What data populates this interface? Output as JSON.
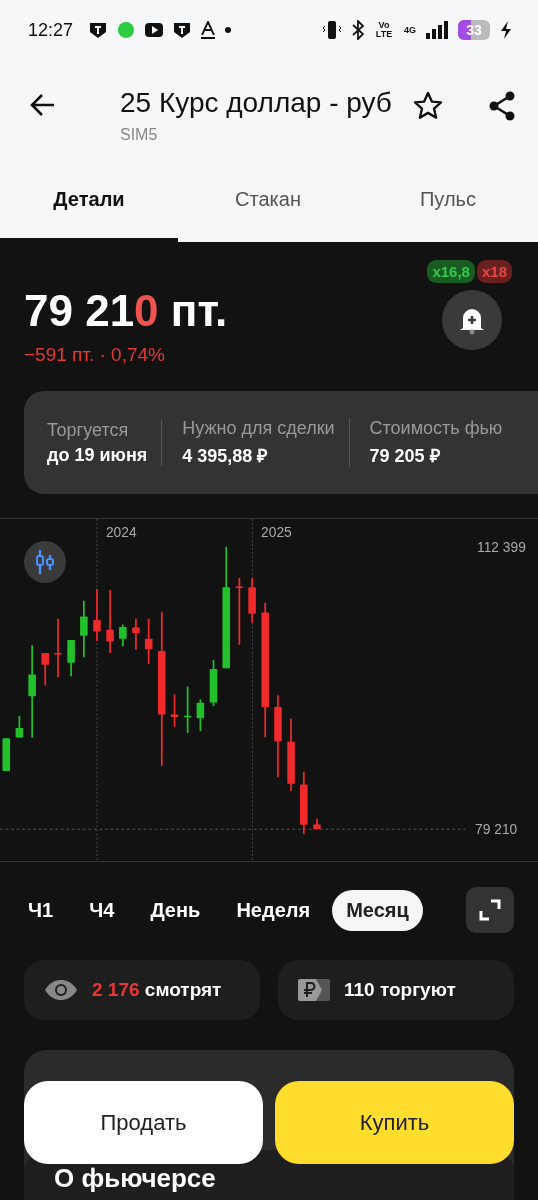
{
  "status_bar": {
    "time": "12:27",
    "network": "4G",
    "volte": "Vo LTE",
    "battery": "33"
  },
  "header": {
    "title": "25 Курс доллар - руб",
    "subtitle": "SIM5"
  },
  "tabs": [
    {
      "label": "Детали",
      "selected": true
    },
    {
      "label": "Стакан",
      "selected": false
    },
    {
      "label": "Пульс",
      "selected": false
    }
  ],
  "quote": {
    "price_parts": [
      {
        "text": "79 21",
        "highlight": false
      },
      {
        "text": "0",
        "highlight": true
      }
    ],
    "unit": "пт.",
    "change": "−591 пт. · 0,74%"
  },
  "leverage": [
    {
      "label": "x16,8",
      "color": "#185c22"
    },
    {
      "label": "x18",
      "color": "#6b2020"
    }
  ],
  "info": [
    {
      "label": "Торгуется",
      "value": "до 19 июня"
    },
    {
      "label": "Нужно для сделки",
      "value": "4 395,88 ₽"
    },
    {
      "label": "Стоимость фью",
      "value": "79 205 ₽"
    }
  ],
  "chart": {
    "years": [
      "2024",
      "2025"
    ],
    "price_high": "112 399",
    "price_last": "79 210"
  },
  "periods": [
    {
      "label": "Ч1",
      "selected": false
    },
    {
      "label": "Ч4",
      "selected": false
    },
    {
      "label": "День",
      "selected": false
    },
    {
      "label": "Неделя",
      "selected": false
    },
    {
      "label": "Месяц",
      "selected": true
    }
  ],
  "stats": [
    {
      "kind": "viewers",
      "count": "2 176",
      "label": "смотрят"
    },
    {
      "kind": "traders",
      "count": "110 торгуют"
    }
  ],
  "actions": [
    {
      "kind": "sell",
      "label": "Продать"
    },
    {
      "kind": "buy",
      "label": "Купить"
    }
  ],
  "section_title": "О фьючерсе"
}
